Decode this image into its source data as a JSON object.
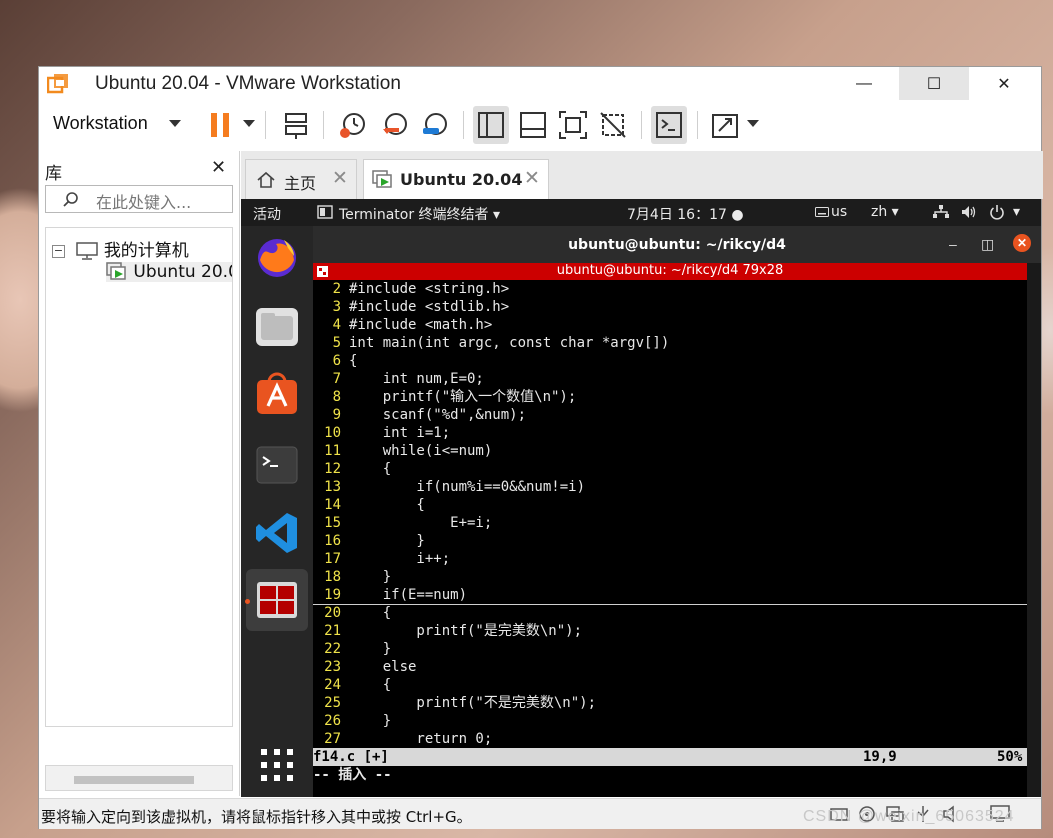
{
  "window": {
    "title": "Ubuntu 20.04 - VMware Workstation",
    "minimize": "—",
    "maximize": "☐",
    "close": "✕"
  },
  "toolbar": {
    "menu_label": "Workstation"
  },
  "library": {
    "title": "库",
    "close": "✕",
    "search_placeholder": "在此处键入...",
    "tree": {
      "root_toggle": "−",
      "root_label": "我的计算机",
      "vm_label": "Ubuntu 20.04"
    }
  },
  "tabs": [
    {
      "label": "主页",
      "close": "✕"
    },
    {
      "label": "Ubuntu 20.04",
      "close": "✕"
    }
  ],
  "guest_topbar": {
    "activities": "活动",
    "app_menu": "Terminator 终端终结者 ▾",
    "datetime": "7月4日  16：17  ●",
    "keyboard": "us",
    "input_method": "zh ▾",
    "system_menu_caret": "▾"
  },
  "terminal": {
    "window_title": "ubuntu@ubuntu: ~/rikcy/d4",
    "minimize": "–",
    "restore": "◫",
    "close": "✕",
    "pane_title": "ubuntu@ubuntu: ~/rikcy/d4 79x28",
    "code_lines": [
      {
        "n": "2",
        "t": "#include <string.h>"
      },
      {
        "n": "3",
        "t": "#include <stdlib.h>"
      },
      {
        "n": "4",
        "t": "#include <math.h>"
      },
      {
        "n": "5",
        "t": "int main(int argc, const char *argv[])"
      },
      {
        "n": "6",
        "t": "{"
      },
      {
        "n": "7",
        "t": "    int num,E=0;"
      },
      {
        "n": "8",
        "t": "    printf(\"输入一个数值\\n\");"
      },
      {
        "n": "9",
        "t": "    scanf(\"%d\",&num);"
      },
      {
        "n": "10",
        "t": "    int i=1;"
      },
      {
        "n": "11",
        "t": "    while(i<=num)"
      },
      {
        "n": "12",
        "t": "    {"
      },
      {
        "n": "13",
        "t": "        if(num%i==0&&num!=i)"
      },
      {
        "n": "14",
        "t": "        {"
      },
      {
        "n": "15",
        "t": "            E+=i;"
      },
      {
        "n": "16",
        "t": "        }"
      },
      {
        "n": "17",
        "t": "        i++;"
      },
      {
        "n": "18",
        "t": "    }"
      },
      {
        "n": "19",
        "t": "    if(E==num)"
      },
      {
        "n": "20",
        "t": "    {"
      },
      {
        "n": "21",
        "t": "        printf(\"是完美数\\n\");"
      },
      {
        "n": "22",
        "t": "    }"
      },
      {
        "n": "23",
        "t": "    else"
      },
      {
        "n": "24",
        "t": "    {"
      },
      {
        "n": "25",
        "t": "        printf(\"不是完美数\\n\");"
      },
      {
        "n": "26",
        "t": "    }"
      },
      {
        "n": "27",
        "t": "        return 0;"
      }
    ],
    "status": {
      "filename": "f14.c [+]",
      "position": "19,9",
      "percent": "50%"
    },
    "mode": "-- 插入 --"
  },
  "statusbar": {
    "text": "要将输入定向到该虚拟机，请将鼠标指针移入其中或按 Ctrl+G。",
    "watermark": "CSDN @weixin_65063524"
  },
  "colors": {
    "terminal_red": "#cc0000",
    "ubuntu_orange": "#e95420",
    "vmware_pause": "#f57c1f",
    "line_number": "#f0e34a"
  }
}
